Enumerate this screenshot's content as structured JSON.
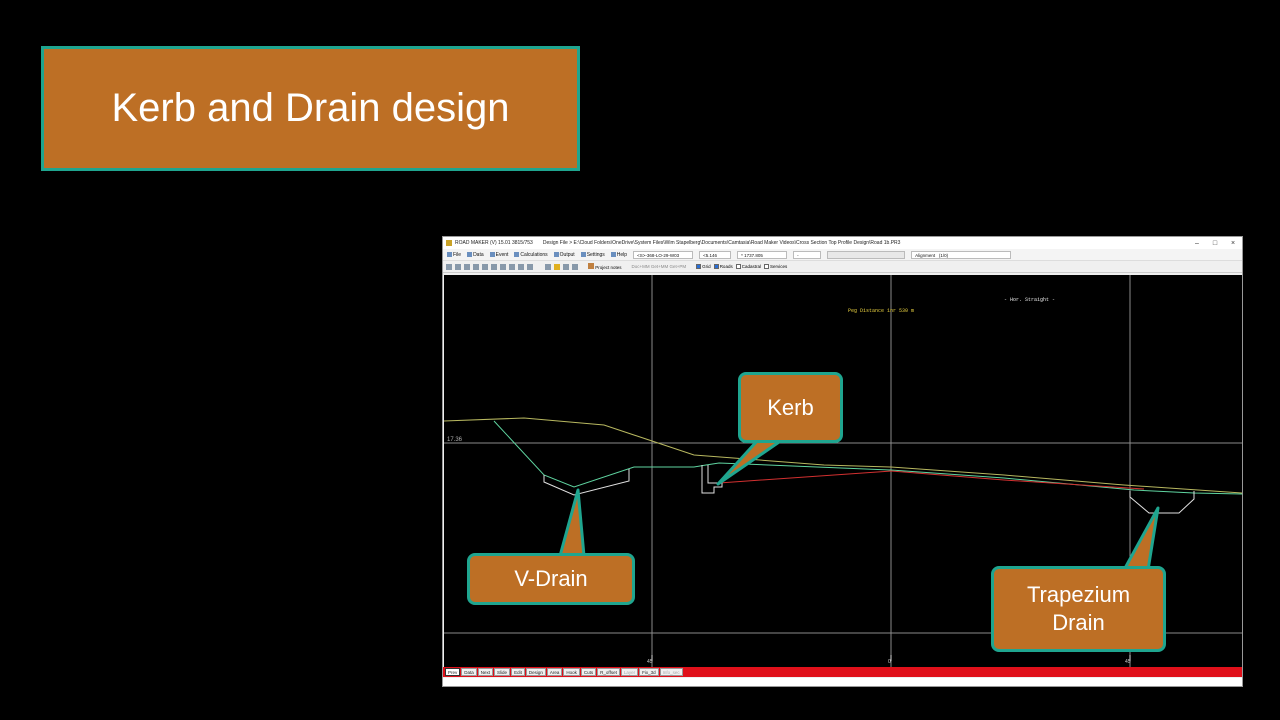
{
  "slide": {
    "title": "Kerb and Drain design"
  },
  "app": {
    "window_title": "ROAD MAKER (V) 15.01  3815/753",
    "design_file": "Design File > E:\\Cloud Folders\\OneDrive\\System Files\\Wim Stapelberg\\Documents\\Camtasia\\Road Maker Videos\\Cross Section Top Profile Design\\Road 1b.PR3",
    "menu": [
      "File",
      "Data",
      "Event",
      "Calculations",
      "Output",
      "Settings",
      "Help"
    ],
    "coord_fields": [
      "<S>-368-LO-29-W03",
      "<5.146",
      "* 1737.805",
      "-"
    ],
    "alignment_label": "Alignment",
    "alignment_value": "(1/0)",
    "toolbar": {
      "project_notes": "Project notes",
      "doc_items": "Doc+MM  Get+MM  Get+PM",
      "grid_label": "Grid",
      "roads_label": "Roads",
      "cadastral_label": "Cadastral",
      "services_label": "Services"
    },
    "canvas": {
      "annotation_top": "- Hor. Straight -",
      "annotation_peg": "Peg Distance 1nr 530 m",
      "y_label": "17.36",
      "x_ticks": [
        "45",
        "0",
        "45"
      ]
    },
    "tabs": [
      "Prev",
      "Data",
      "Next",
      "Slide",
      "Edit",
      "Design",
      "Area",
      "Hook",
      "Cuts",
      "R_offset",
      "Layer",
      "Fix_3d",
      "Info_sec"
    ],
    "active_tab": "Prev",
    "dim_tabs": [
      "Layer",
      "Info_sec"
    ]
  },
  "callouts": {
    "kerb": "Kerb",
    "v_drain": "V-Drain",
    "trap_line1": "Trapezium",
    "trap_line2": "Drain"
  },
  "colors": {
    "accent_orange": "#bd6f25",
    "border_teal": "#1fa58f",
    "tab_red": "#e0101a",
    "surface_green": "#5fd4a0",
    "design_red": "#d23030"
  }
}
